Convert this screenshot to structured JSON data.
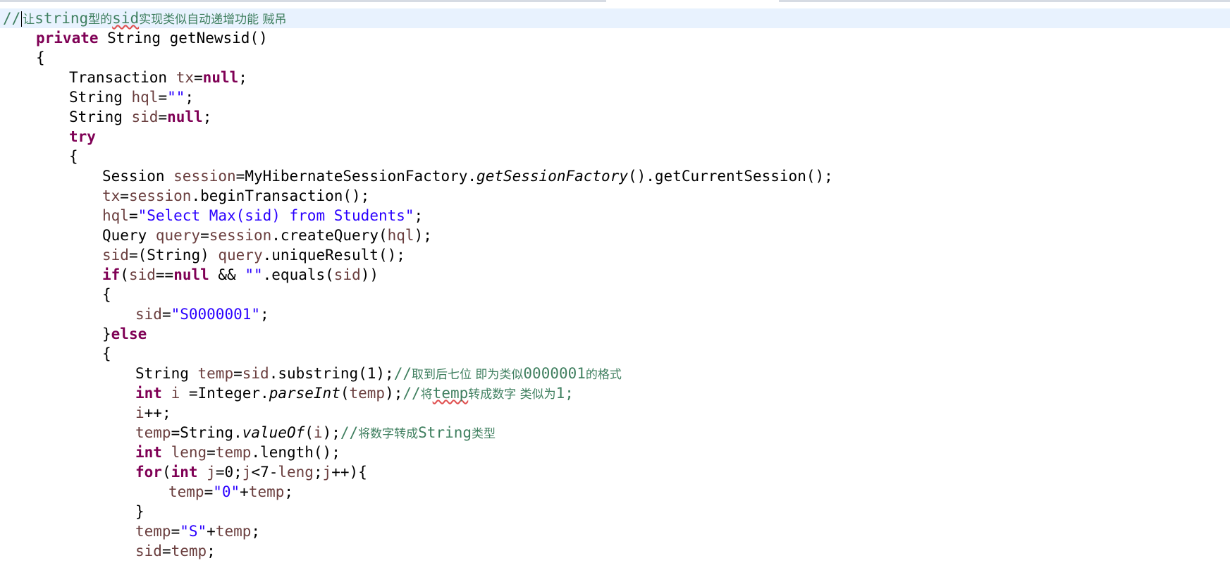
{
  "editor": {
    "tab_strip": [
      {
        "state": "inactive"
      },
      {
        "state": "inactive"
      }
    ],
    "lines": [
      {
        "indent": 0,
        "current": true,
        "tokens": [
          {
            "t": "//",
            "c": "cmt"
          },
          {
            "caret": true
          },
          {
            "t": "让",
            "c": "cmt cjk"
          },
          {
            "t": "string",
            "c": "cmt"
          },
          {
            "t": "型的",
            "c": "cmt cjk"
          },
          {
            "t": "sid",
            "c": "cmt wavy"
          },
          {
            "t": "实现类似自动递增功能 贼吊",
            "c": "cmt cjk"
          }
        ]
      },
      {
        "indent": 1,
        "tokens": [
          {
            "t": "private",
            "c": "kw"
          },
          {
            "t": " String getNewsid()"
          }
        ]
      },
      {
        "indent": 1,
        "tokens": [
          {
            "t": "{"
          }
        ]
      },
      {
        "indent": 2,
        "tokens": [
          {
            "t": "Transaction "
          },
          {
            "t": "tx",
            "c": "var"
          },
          {
            "t": "="
          },
          {
            "t": "null",
            "c": "kw"
          },
          {
            "t": ";"
          }
        ]
      },
      {
        "indent": 2,
        "tokens": [
          {
            "t": "String "
          },
          {
            "t": "hql",
            "c": "var"
          },
          {
            "t": "="
          },
          {
            "t": "\"\"",
            "c": "str"
          },
          {
            "t": ";"
          }
        ]
      },
      {
        "indent": 2,
        "tokens": [
          {
            "t": "String "
          },
          {
            "t": "sid",
            "c": "var"
          },
          {
            "t": "="
          },
          {
            "t": "null",
            "c": "kw"
          },
          {
            "t": ";"
          }
        ]
      },
      {
        "indent": 2,
        "tokens": [
          {
            "t": "try",
            "c": "kw"
          }
        ]
      },
      {
        "indent": 2,
        "tokens": [
          {
            "t": "{"
          }
        ]
      },
      {
        "indent": 3,
        "tokens": [
          {
            "t": "Session "
          },
          {
            "t": "session",
            "c": "var"
          },
          {
            "t": "=MyHibernateSessionFactory."
          },
          {
            "t": "getSessionFactory",
            "c": "it"
          },
          {
            "t": "().getCurrentSession();"
          }
        ]
      },
      {
        "indent": 3,
        "tokens": [
          {
            "t": "tx",
            "c": "var"
          },
          {
            "t": "="
          },
          {
            "t": "session",
            "c": "var"
          },
          {
            "t": ".beginTransaction();"
          }
        ]
      },
      {
        "indent": 3,
        "tokens": [
          {
            "t": "hql",
            "c": "var"
          },
          {
            "t": "="
          },
          {
            "t": "\"Select Max(sid) from Students\"",
            "c": "str"
          },
          {
            "t": ";"
          }
        ]
      },
      {
        "indent": 3,
        "tokens": [
          {
            "t": "Query "
          },
          {
            "t": "query",
            "c": "var"
          },
          {
            "t": "="
          },
          {
            "t": "session",
            "c": "var"
          },
          {
            "t": ".createQuery("
          },
          {
            "t": "hql",
            "c": "var"
          },
          {
            "t": ");"
          }
        ]
      },
      {
        "indent": 3,
        "tokens": [
          {
            "t": "sid",
            "c": "var"
          },
          {
            "t": "=(String) "
          },
          {
            "t": "query",
            "c": "var"
          },
          {
            "t": ".uniqueResult();"
          }
        ]
      },
      {
        "indent": 3,
        "tokens": [
          {
            "t": "if",
            "c": "kw"
          },
          {
            "t": "("
          },
          {
            "t": "sid",
            "c": "var"
          },
          {
            "t": "=="
          },
          {
            "t": "null",
            "c": "kw"
          },
          {
            "t": " && "
          },
          {
            "t": "\"\"",
            "c": "str"
          },
          {
            "t": ".equals("
          },
          {
            "t": "sid",
            "c": "var"
          },
          {
            "t": "))"
          }
        ]
      },
      {
        "indent": 3,
        "tokens": [
          {
            "t": "{"
          }
        ]
      },
      {
        "indent": 4,
        "tokens": [
          {
            "t": "sid",
            "c": "var"
          },
          {
            "t": "="
          },
          {
            "t": "\"S0000001\"",
            "c": "str"
          },
          {
            "t": ";"
          }
        ]
      },
      {
        "indent": 3,
        "tokens": [
          {
            "t": "}"
          },
          {
            "t": "else",
            "c": "kw"
          }
        ]
      },
      {
        "indent": 3,
        "tokens": [
          {
            "t": "{"
          }
        ]
      },
      {
        "indent": 4,
        "tokens": [
          {
            "t": "String "
          },
          {
            "t": "temp",
            "c": "var"
          },
          {
            "t": "="
          },
          {
            "t": "sid",
            "c": "var"
          },
          {
            "t": ".substring(1);"
          },
          {
            "t": "//",
            "c": "cmt"
          },
          {
            "t": "取到后七位 即为类似",
            "c": "cmt cjk"
          },
          {
            "t": "0000001",
            "c": "cmt"
          },
          {
            "t": "的格式",
            "c": "cmt cjk"
          }
        ]
      },
      {
        "indent": 4,
        "tokens": [
          {
            "t": "int",
            "c": "kw"
          },
          {
            "t": " "
          },
          {
            "t": "i",
            "c": "var"
          },
          {
            "t": " =Integer."
          },
          {
            "t": "parseInt",
            "c": "it"
          },
          {
            "t": "("
          },
          {
            "t": "temp",
            "c": "var"
          },
          {
            "t": ");"
          },
          {
            "t": "//",
            "c": "cmt"
          },
          {
            "t": "将",
            "c": "cmt cjk"
          },
          {
            "t": "temp",
            "c": "cmt wavy"
          },
          {
            "t": "转成数字 类似为",
            "c": "cmt cjk"
          },
          {
            "t": "1;",
            "c": "cmt"
          }
        ]
      },
      {
        "indent": 4,
        "tokens": [
          {
            "t": "i",
            "c": "var"
          },
          {
            "t": "++;"
          }
        ]
      },
      {
        "indent": 4,
        "tokens": [
          {
            "t": "temp",
            "c": "var"
          },
          {
            "t": "=String."
          },
          {
            "t": "valueOf",
            "c": "it"
          },
          {
            "t": "("
          },
          {
            "t": "i",
            "c": "var"
          },
          {
            "t": ");"
          },
          {
            "t": "//",
            "c": "cmt"
          },
          {
            "t": "将数字转成",
            "c": "cmt cjk"
          },
          {
            "t": "String",
            "c": "cmt"
          },
          {
            "t": "类型",
            "c": "cmt cjk"
          }
        ]
      },
      {
        "indent": 4,
        "tokens": [
          {
            "t": "int",
            "c": "kw"
          },
          {
            "t": " "
          },
          {
            "t": "leng",
            "c": "var"
          },
          {
            "t": "="
          },
          {
            "t": "temp",
            "c": "var"
          },
          {
            "t": ".length();"
          }
        ]
      },
      {
        "indent": 4,
        "tokens": [
          {
            "t": "for",
            "c": "kw"
          },
          {
            "t": "("
          },
          {
            "t": "int",
            "c": "kw"
          },
          {
            "t": " "
          },
          {
            "t": "j",
            "c": "var"
          },
          {
            "t": "=0;"
          },
          {
            "t": "j",
            "c": "var"
          },
          {
            "t": "<7-"
          },
          {
            "t": "leng",
            "c": "var"
          },
          {
            "t": ";"
          },
          {
            "t": "j",
            "c": "var"
          },
          {
            "t": "++){"
          }
        ]
      },
      {
        "indent": 5,
        "tokens": [
          {
            "t": "temp",
            "c": "var"
          },
          {
            "t": "="
          },
          {
            "t": "\"0\"",
            "c": "str"
          },
          {
            "t": "+"
          },
          {
            "t": "temp",
            "c": "var"
          },
          {
            "t": ";"
          }
        ]
      },
      {
        "indent": 4,
        "tokens": [
          {
            "t": "}"
          }
        ]
      },
      {
        "indent": 4,
        "tokens": [
          {
            "t": "temp",
            "c": "var"
          },
          {
            "t": "="
          },
          {
            "t": "\"S\"",
            "c": "str"
          },
          {
            "t": "+"
          },
          {
            "t": "temp",
            "c": "var"
          },
          {
            "t": ";"
          }
        ]
      },
      {
        "indent": 4,
        "tokens": [
          {
            "t": "sid",
            "c": "var"
          },
          {
            "t": "="
          },
          {
            "t": "temp",
            "c": "var"
          },
          {
            "t": ";"
          }
        ]
      }
    ]
  }
}
